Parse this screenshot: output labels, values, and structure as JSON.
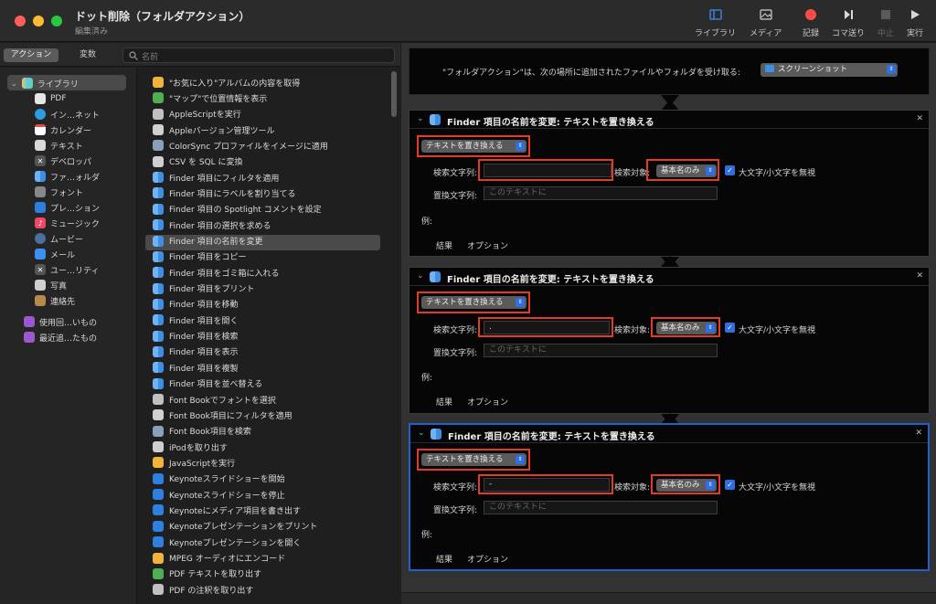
{
  "window": {
    "title": "ドット削除（フォルダアクション）",
    "subtitle": "編集済み"
  },
  "toolbar": {
    "library": "ライブラリ",
    "media": "メディア",
    "record": "記録",
    "step": "コマ送り",
    "stop": "中止",
    "run": "実行"
  },
  "left_tabs": {
    "actions": "アクション",
    "variables": "変数"
  },
  "search": {
    "placeholder": "名前"
  },
  "library": [
    {
      "label": "ライブラリ",
      "icon": "library-icon"
    },
    {
      "label": "PDF",
      "icon": "pdf-icon"
    },
    {
      "label": "イン…ネット",
      "icon": "globe-icon"
    },
    {
      "label": "カレンダー",
      "icon": "calendar-icon"
    },
    {
      "label": "テキスト",
      "icon": "text-icon"
    },
    {
      "label": "デベロッパ",
      "icon": "developer-icon"
    },
    {
      "label": "ファ…ォルダ",
      "icon": "finder-icon"
    },
    {
      "label": "フォント",
      "icon": "font-icon"
    },
    {
      "label": "プレ…ション",
      "icon": "presentation-icon"
    },
    {
      "label": "ミュージック",
      "icon": "music-icon"
    },
    {
      "label": "ムービー",
      "icon": "movie-icon"
    },
    {
      "label": "メール",
      "icon": "mail-icon"
    },
    {
      "label": "ユー…リティ",
      "icon": "utility-icon"
    },
    {
      "label": "写真",
      "icon": "photos-icon"
    },
    {
      "label": "連絡先",
      "icon": "contacts-icon"
    },
    {
      "label": "使用回…いもの",
      "icon": "folder-icon"
    },
    {
      "label": "最近追…たもの",
      "icon": "folder-icon"
    }
  ],
  "actions": [
    "\"お気に入り\"アルバムの内容を取得",
    "\"マップ\"で位置情報を表示",
    "AppleScriptを実行",
    "Appleバージョン管理ツール",
    "ColorSync プロファイルをイメージに適用",
    "CSV を SQL に変換",
    "Finder 項目にフィルタを適用",
    "Finder 項目にラベルを割り当てる",
    "Finder 項目の Spotlight コメントを設定",
    "Finder 項目の選択を求める",
    "Finder 項目の名前を変更",
    "Finder 項目をコピー",
    "Finder 項目をゴミ箱に入れる",
    "Finder 項目をプリント",
    "Finder 項目を移動",
    "Finder 項目を開く",
    "Finder 項目を検索",
    "Finder 項目を表示",
    "Finder 項目を複製",
    "Finder 項目を並べ替える",
    "Font Bookでフォントを選択",
    "Font Book項目にフィルタを適用",
    "Font Book項目を検索",
    "iPodを取り出す",
    "JavaScriptを実行",
    "Keynoteスライドショーを開始",
    "Keynoteスライドショーを停止",
    "Keynoteにメディア項目を書き出す",
    "Keynoteプレゼンテーションをプリント",
    "Keynoteプレゼンテーションを開く",
    "MPEG オーディオにエンコード",
    "PDF テキストを取り出す",
    "PDF の注釈を取り出す"
  ],
  "folder_action": {
    "label": "\"フォルダアクション\"は、次の場所に追加されたファイルやフォルダを受け取る:",
    "folder": "スクリーンショット"
  },
  "cards": [
    {
      "title": "Finder 項目の名前を変更: テキストを置き換える",
      "mode": "テキストを置き換える",
      "search_label": "検索文字列:",
      "search_value": "",
      "target_label": "検索対象:",
      "target_value": "基本名のみ",
      "ignore_case": "大文字/小文字を無視",
      "replace_label": "置換文字列:",
      "replace_placeholder": "このテキストに",
      "example": "例:",
      "tab_results": "結果",
      "tab_options": "オプション"
    },
    {
      "title": "Finder 項目の名前を変更: テキストを置き換える",
      "mode": "テキストを置き換える",
      "search_label": "検索文字列:",
      "search_value": ".",
      "target_label": "検索対象:",
      "target_value": "基本名のみ",
      "ignore_case": "大文字/小文字を無視",
      "replace_label": "置換文字列:",
      "replace_placeholder": "このテキストに",
      "example": "例:",
      "tab_results": "結果",
      "tab_options": "オプション"
    },
    {
      "title": "Finder 項目の名前を変更: テキストを置き換える",
      "mode": "テキストを置き換える",
      "search_label": "検索文字列:",
      "search_value": "-",
      "target_label": "検索対象:",
      "target_value": "基本名のみ",
      "ignore_case": "大文字/小文字を無視",
      "replace_label": "置換文字列:",
      "replace_placeholder": "このテキストに",
      "example": "例:",
      "tab_results": "結果",
      "tab_options": "オプション"
    }
  ],
  "colors": {
    "accent": "#2f6fe0",
    "highlight": "#e23b2a",
    "record": "#ff4a4a"
  }
}
